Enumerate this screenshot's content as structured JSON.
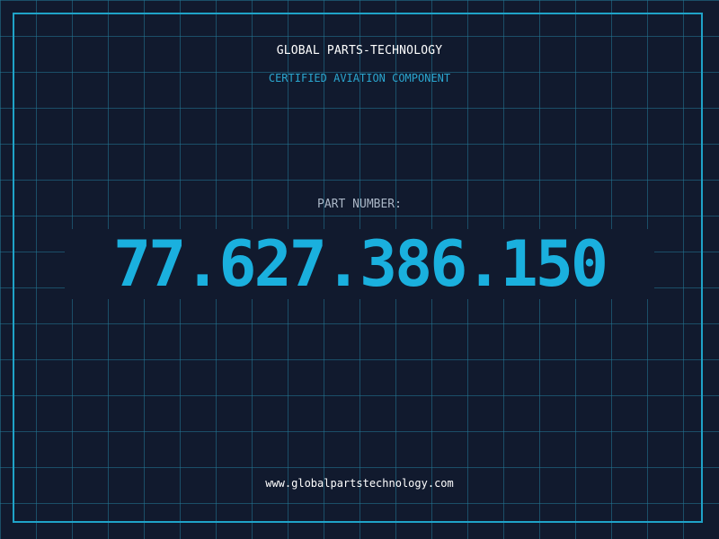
{
  "header": {
    "company_name": "GLOBAL PARTS-TECHNOLOGY",
    "subtitle": "CERTIFIED AVIATION COMPONENT"
  },
  "part": {
    "label": "PART NUMBER:",
    "number": "77.627.386.150"
  },
  "footer": {
    "website": "www.globalpartstechnology.com"
  },
  "colors": {
    "background": "#111a2e",
    "grid": "#23788f",
    "frame": "#1fa3c8",
    "accent": "#1ab0de",
    "text": "#ffffff"
  }
}
